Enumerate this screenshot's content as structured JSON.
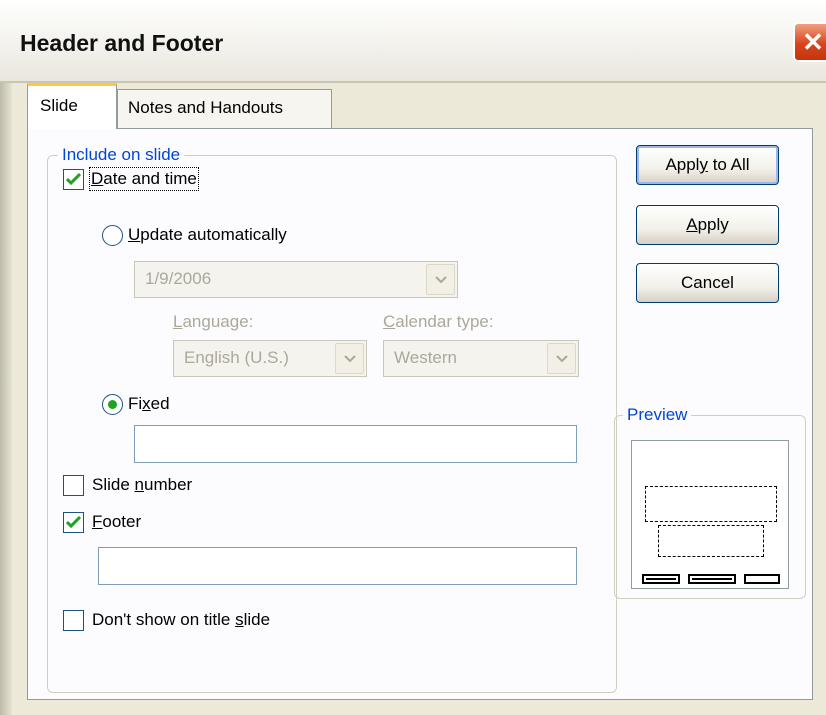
{
  "window": {
    "title": "Header and Footer",
    "close_glyph": "✕"
  },
  "tabs": [
    {
      "label": "Slide",
      "active": true
    },
    {
      "label": "Notes and Handouts",
      "active": false
    }
  ],
  "group_include": {
    "legend": "Include on slide",
    "date_time": {
      "label_u": "D",
      "label_rest": "ate and time",
      "checked": true
    },
    "update_automatically": {
      "label_u": "U",
      "label_rest": "pdate automatically",
      "selected": false
    },
    "date_combo": {
      "value": "1/9/2006"
    },
    "language": {
      "label_u": "L",
      "label_rest": "anguage:",
      "value": "English (U.S.)"
    },
    "calendar_type": {
      "label_u": "C",
      "label_rest": "alendar type:",
      "value": "Western"
    },
    "fixed": {
      "label_pre": "Fi",
      "label_u": "x",
      "label_rest": "ed",
      "selected": true,
      "value": ""
    },
    "slide_number": {
      "label_pre": "Slide ",
      "label_u": "n",
      "label_rest": "umber",
      "checked": false
    },
    "footer": {
      "label_u": "F",
      "label_rest": "ooter",
      "checked": true,
      "value": ""
    }
  },
  "dont_show_title": {
    "label_pre": "Don't show on title ",
    "label_u": "s",
    "label_rest": "lide",
    "checked": false
  },
  "buttons": {
    "apply_all": {
      "label_pre": "Appl",
      "label_u": "y",
      "label_rest": " to All"
    },
    "apply": {
      "label_u": "A",
      "label_rest": "pply"
    },
    "cancel": {
      "label": "Cancel"
    }
  },
  "preview": {
    "legend": "Preview"
  },
  "icons": {
    "check": "check-icon",
    "dropdown": "chevron-down-icon",
    "close": "close-icon"
  },
  "colors": {
    "accent_tab": "#ffc83c",
    "legend_text": "#0046d5",
    "check_green": "#21a121",
    "close_red": "#d9451c"
  }
}
